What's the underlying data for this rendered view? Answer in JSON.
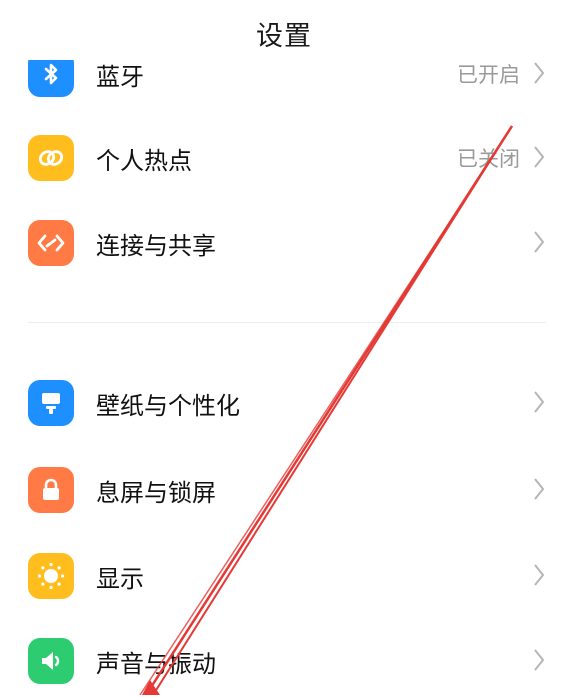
{
  "header": {
    "title": "设置"
  },
  "rows": [
    {
      "label": "蓝牙",
      "value": "已开启",
      "color": "#1e8fff",
      "icon": "bluetooth-icon"
    },
    {
      "label": "个人热点",
      "value": "已关闭",
      "color": "#ffbe1e",
      "icon": "hotspot-icon"
    },
    {
      "label": "连接与共享",
      "value": "",
      "color": "#ff7a45",
      "icon": "connection-share-icon"
    },
    {
      "label": "壁纸与个性化",
      "value": "",
      "color": "#1e8fff",
      "icon": "wallpaper-icon"
    },
    {
      "label": "息屏与锁屏",
      "value": "",
      "color": "#ff7a45",
      "icon": "lock-icon"
    },
    {
      "label": "显示",
      "value": "",
      "color": "#ffbe1e",
      "icon": "display-sun-icon"
    },
    {
      "label": "声音与振动",
      "value": "",
      "color": "#2ecc71",
      "icon": "speaker-icon"
    }
  ],
  "annotation": {
    "color": "#e53935",
    "icon": "red-arrow-icon"
  }
}
